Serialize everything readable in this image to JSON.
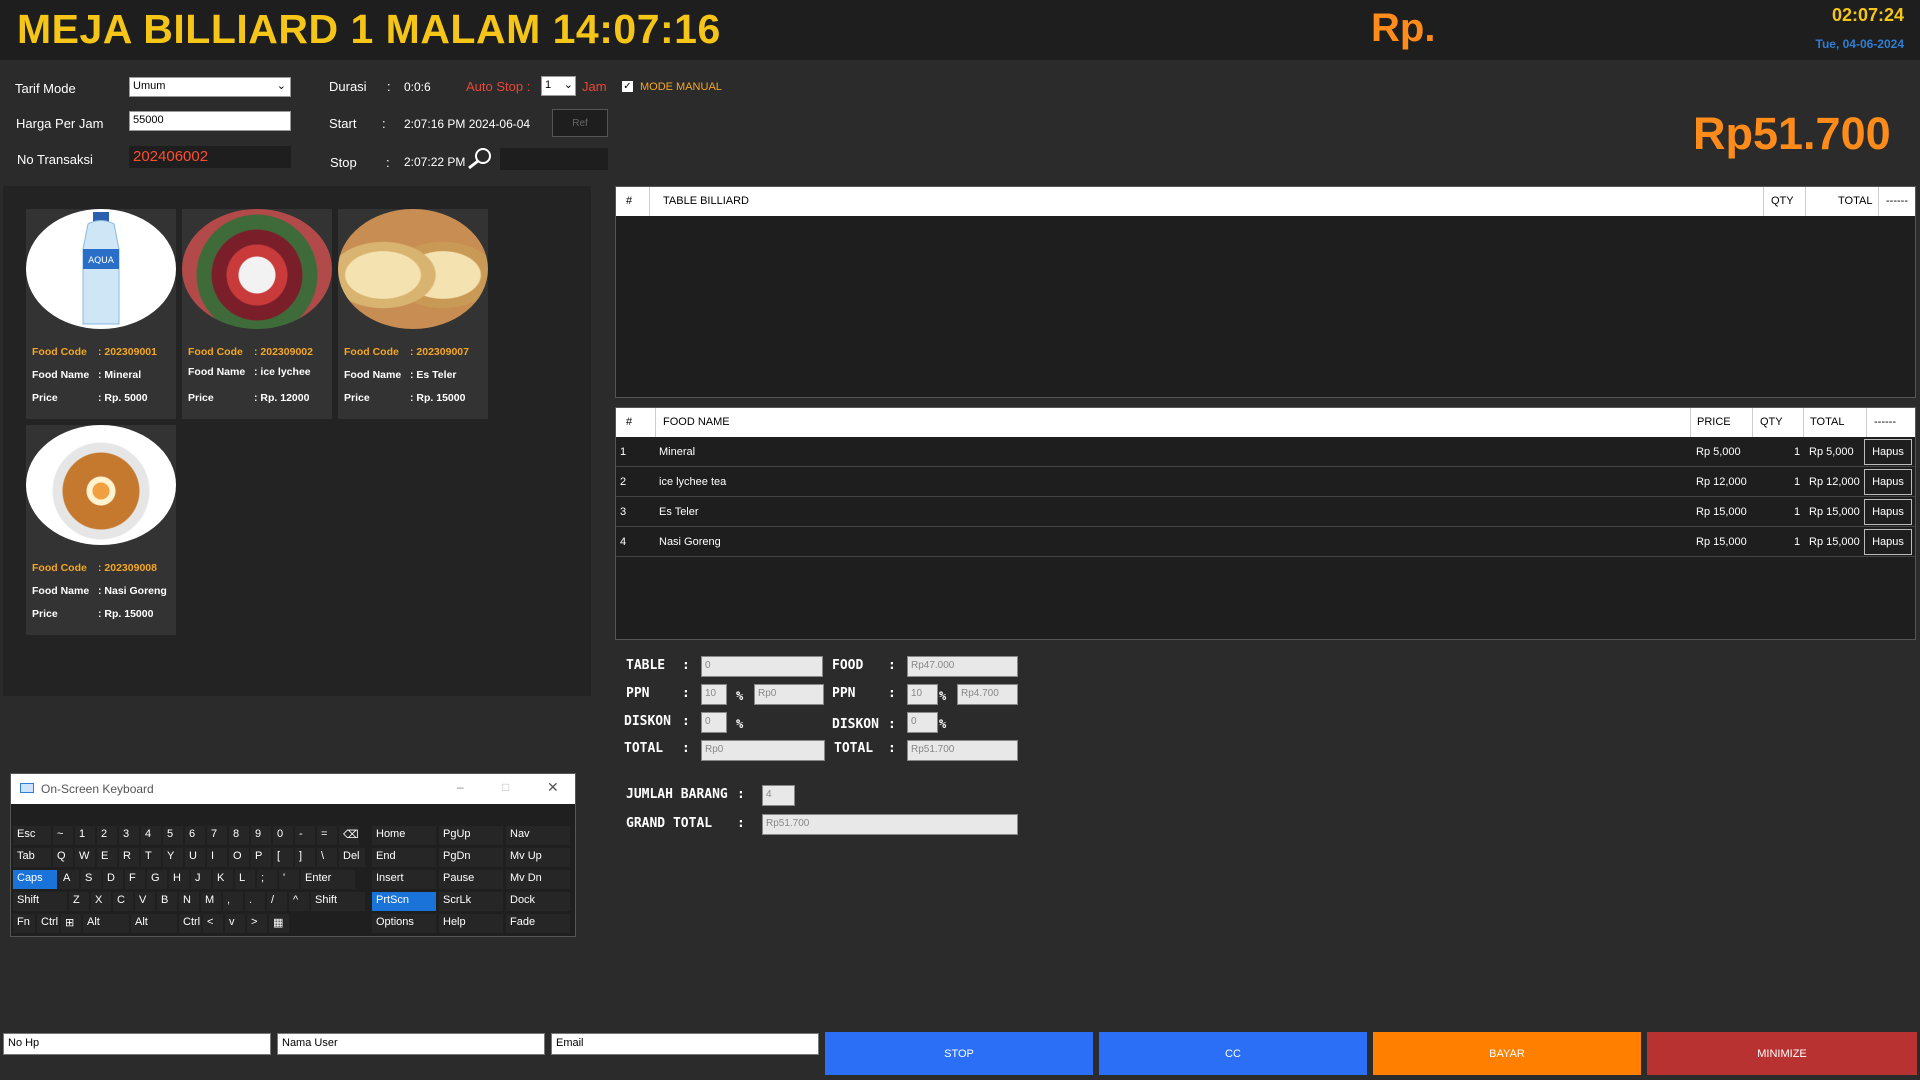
{
  "header": {
    "title": "MEJA BILLIARD 1 MALAM 14:07:16",
    "currency_label": "Rp.",
    "clock": "02:07:24",
    "date": "Tue, 04-06-2024"
  },
  "form": {
    "tarif_mode_label": "Tarif Mode",
    "tarif_mode_value": "Umum",
    "harga_label": "Harga Per Jam",
    "harga_value": "55000",
    "no_transaksi_label": "No Transaksi",
    "no_transaksi_value": "202406002",
    "durasi_label": "Durasi",
    "durasi_colon": ":",
    "durasi_value": "0:0:6",
    "auto_stop_label": "Auto Stop :",
    "auto_stop_value": "1",
    "jam_label": "Jam",
    "mode_manual_label": "MODE MANUAL",
    "start_label": "Start",
    "start_colon": ":",
    "start_value": "2:07:16 PM 2024-06-04",
    "stop_label": "Stop",
    "stop_colon": ":",
    "stop_value": "2:07:22 PM",
    "ref_button": "Ref"
  },
  "big_total": "Rp51.700",
  "foods": [
    {
      "code_label": "Food Code",
      "code": ": 202309001",
      "name_label": "Food Name",
      "name": ": Mineral",
      "price_label": "Price",
      "price": ": Rp. 5000"
    },
    {
      "code_label": "Food Code",
      "code": ": 202309002",
      "name_label": "Food Name",
      "name": ": ice lychee",
      "price_label": "Price",
      "price": ": Rp. 12000"
    },
    {
      "code_label": "Food Code",
      "code": ": 202309007",
      "name_label": "Food Name",
      "name": ": Es Teler",
      "price_label": "Price",
      "price": ": Rp. 15000"
    },
    {
      "code_label": "Food Code",
      "code": ": 202309008",
      "name_label": "Food Name",
      "name": ": Nasi Goreng",
      "price_label": "Price",
      "price": ": Rp. 15000"
    }
  ],
  "billiard_table": {
    "headers": [
      "#",
      "TABLE BILLIARD",
      "QTY",
      "TOTAL",
      "------"
    ]
  },
  "food_table": {
    "headers": [
      "#",
      "FOOD NAME",
      "PRICE",
      "QTY",
      "TOTAL",
      "------"
    ],
    "rows": [
      {
        "no": "1",
        "name": "Mineral",
        "price": "Rp  5,000",
        "qty": "1",
        "total": "Rp  5,000",
        "action": "Hapus"
      },
      {
        "no": "2",
        "name": "ice lychee tea",
        "price": "Rp  12,000",
        "qty": "1",
        "total": "Rp  12,000",
        "action": "Hapus"
      },
      {
        "no": "3",
        "name": "Es Teler",
        "price": "Rp  15,000",
        "qty": "1",
        "total": "Rp  15,000",
        "action": "Hapus"
      },
      {
        "no": "4",
        "name": "Nasi Goreng",
        "price": "Rp  15,000",
        "qty": "1",
        "total": "Rp  15,000",
        "action": "Hapus"
      }
    ]
  },
  "summary": {
    "colon": ":",
    "pct": "%",
    "table_label": "TABLE",
    "table_value": "0",
    "food_label": "FOOD",
    "food_value": "Rp47.000",
    "ppn_label": "PPN",
    "ppn_table_pct": "10",
    "ppn_table_value": "Rp0",
    "ppn_food_pct": "10",
    "ppn_food_value": "Rp4.700",
    "diskon_label": "DISKON",
    "diskon_table": "0",
    "diskon_food": "0",
    "total_label": "TOTAL",
    "total_table": "Rp0",
    "total_food": "Rp51.700",
    "jumlah_label": "JUMLAH BARANG",
    "jumlah_value": "4",
    "grand_label": "GRAND TOTAL",
    "grand_value": "Rp51.700"
  },
  "osk": {
    "title": "On-Screen Keyboard",
    "rows": [
      [
        "Esc",
        "~",
        "1",
        "2",
        "3",
        "4",
        "5",
        "6",
        "7",
        "8",
        "9",
        "0",
        "-",
        "=",
        "⌫"
      ],
      [
        "Tab",
        "Q",
        "W",
        "E",
        "R",
        "T",
        "Y",
        "U",
        "I",
        "O",
        "P",
        "[",
        "]",
        "\\",
        "Del"
      ],
      [
        "Caps",
        "A",
        "S",
        "D",
        "F",
        "G",
        "H",
        "J",
        "K",
        "L",
        ";",
        "'",
        "Enter"
      ],
      [
        "Shift",
        "Z",
        "X",
        "C",
        "V",
        "B",
        "N",
        "M",
        ",",
        ".",
        "/",
        "^",
        "Shift"
      ],
      [
        "Fn",
        "Ctrl",
        "⊞",
        "Alt",
        "Alt",
        "Ctrl",
        "<",
        "v",
        ">",
        "▦"
      ]
    ],
    "side": [
      [
        "Home",
        "PgUp",
        "Nav"
      ],
      [
        "End",
        "PgDn",
        "Mv Up"
      ],
      [
        "Insert",
        "Pause",
        "Mv Dn"
      ],
      [
        "PrtScn",
        "ScrLk",
        "Dock"
      ],
      [
        "Options",
        "Help",
        "Fade"
      ]
    ]
  },
  "footer": {
    "no_hp_placeholder": "No Hp",
    "nama_placeholder": "Nama User",
    "email_placeholder": "Email",
    "stop": "STOP",
    "cc": "CC",
    "bayar": "BAYAR",
    "minimize": "MINIMIZE",
    "colors": {
      "stop": "#2a6ff5",
      "cc": "#2a6ff5",
      "bayar": "#ff8000",
      "minimize": "#b83232"
    }
  }
}
